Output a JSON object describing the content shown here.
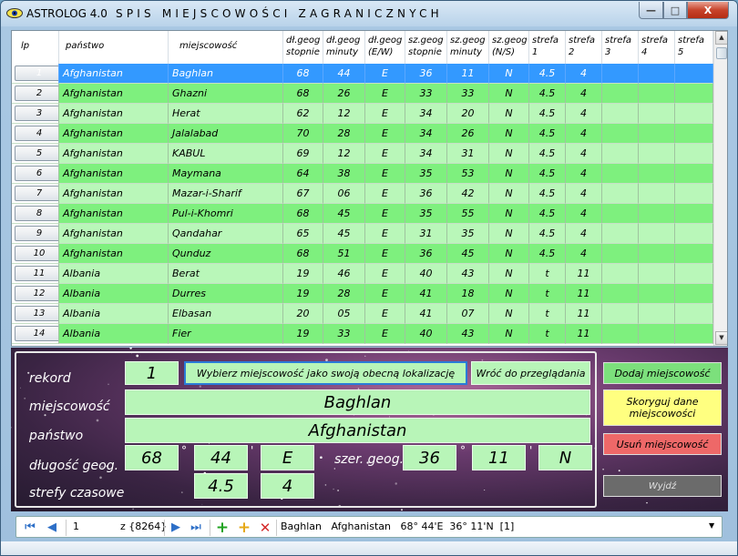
{
  "window": {
    "app_title": "ASTROLOG 4.0",
    "subtitle": "SPIS MIEJSCOWOŚCI ZAGRANICZNYCH",
    "min_label": "—",
    "max_label": "□",
    "close_label": "X"
  },
  "grid": {
    "columns": [
      "lp",
      "państwo",
      "miejscowość",
      "dł.geog\nstopnie",
      "dł.geog\nminuty",
      "dł.geog\n(E/W)",
      "sz.geog\nstopnie",
      "sz.geog\nminuty",
      "sz.geog\n(N/S)",
      "strefa\n1",
      "strefa\n2",
      "strefa\n3",
      "strefa\n4",
      "strefa\n5"
    ],
    "selected_row": 0,
    "rows": [
      {
        "lp": "1",
        "country": "Afghanistan",
        "city": "Baghlan",
        "lon_deg": "68",
        "lon_min": "44",
        "lon_dir": "E",
        "lat_deg": "36",
        "lat_min": "11",
        "lat_dir": "N",
        "tz1": "4.5",
        "tz2": "4"
      },
      {
        "lp": "2",
        "country": "Afghanistan",
        "city": "Ghazni",
        "lon_deg": "68",
        "lon_min": "26",
        "lon_dir": "E",
        "lat_deg": "33",
        "lat_min": "33",
        "lat_dir": "N",
        "tz1": "4.5",
        "tz2": "4"
      },
      {
        "lp": "3",
        "country": "Afghanistan",
        "city": "Herat",
        "lon_deg": "62",
        "lon_min": "12",
        "lon_dir": "E",
        "lat_deg": "34",
        "lat_min": "20",
        "lat_dir": "N",
        "tz1": "4.5",
        "tz2": "4"
      },
      {
        "lp": "4",
        "country": "Afghanistan",
        "city": "Jalalabad",
        "lon_deg": "70",
        "lon_min": "28",
        "lon_dir": "E",
        "lat_deg": "34",
        "lat_min": "26",
        "lat_dir": "N",
        "tz1": "4.5",
        "tz2": "4"
      },
      {
        "lp": "5",
        "country": "Afghanistan",
        "city": "KABUL",
        "lon_deg": "69",
        "lon_min": "12",
        "lon_dir": "E",
        "lat_deg": "34",
        "lat_min": "31",
        "lat_dir": "N",
        "tz1": "4.5",
        "tz2": "4"
      },
      {
        "lp": "6",
        "country": "Afghanistan",
        "city": "Maymana",
        "lon_deg": "64",
        "lon_min": "38",
        "lon_dir": "E",
        "lat_deg": "35",
        "lat_min": "53",
        "lat_dir": "N",
        "tz1": "4.5",
        "tz2": "4"
      },
      {
        "lp": "7",
        "country": "Afghanistan",
        "city": "Mazar-i-Sharif",
        "lon_deg": "67",
        "lon_min": "06",
        "lon_dir": "E",
        "lat_deg": "36",
        "lat_min": "42",
        "lat_dir": "N",
        "tz1": "4.5",
        "tz2": "4"
      },
      {
        "lp": "8",
        "country": "Afghanistan",
        "city": "Pul-i-Khomri",
        "lon_deg": "68",
        "lon_min": "45",
        "lon_dir": "E",
        "lat_deg": "35",
        "lat_min": "55",
        "lat_dir": "N",
        "tz1": "4.5",
        "tz2": "4"
      },
      {
        "lp": "9",
        "country": "Afghanistan",
        "city": "Qandahar",
        "lon_deg": "65",
        "lon_min": "45",
        "lon_dir": "E",
        "lat_deg": "31",
        "lat_min": "35",
        "lat_dir": "N",
        "tz1": "4.5",
        "tz2": "4"
      },
      {
        "lp": "10",
        "country": "Afghanistan",
        "city": "Qunduz",
        "lon_deg": "68",
        "lon_min": "51",
        "lon_dir": "E",
        "lat_deg": "36",
        "lat_min": "45",
        "lat_dir": "N",
        "tz1": "4.5",
        "tz2": "4"
      },
      {
        "lp": "11",
        "country": "Albania",
        "city": "Berat",
        "lon_deg": "19",
        "lon_min": "46",
        "lon_dir": "E",
        "lat_deg": "40",
        "lat_min": "43",
        "lat_dir": "N",
        "tz1": "t",
        "tz2": "11"
      },
      {
        "lp": "12",
        "country": "Albania",
        "city": "Durres",
        "lon_deg": "19",
        "lon_min": "28",
        "lon_dir": "E",
        "lat_deg": "41",
        "lat_min": "18",
        "lat_dir": "N",
        "tz1": "t",
        "tz2": "11"
      },
      {
        "lp": "13",
        "country": "Albania",
        "city": "Elbasan",
        "lon_deg": "20",
        "lon_min": "05",
        "lon_dir": "E",
        "lat_deg": "41",
        "lat_min": "07",
        "lat_dir": "N",
        "tz1": "t",
        "tz2": "11"
      },
      {
        "lp": "14",
        "country": "Albania",
        "city": "Fier",
        "lon_deg": "19",
        "lon_min": "33",
        "lon_dir": "E",
        "lat_deg": "40",
        "lat_min": "43",
        "lat_dir": "N",
        "tz1": "t",
        "tz2": "11"
      }
    ]
  },
  "form": {
    "label_record": "rekord",
    "label_city": "miejscowość",
    "label_country": "państwo",
    "label_lon": "długość geog.",
    "label_lat": "szer. geog.",
    "label_tz": "strefy czasowe",
    "record": "1",
    "city": "Baghlan",
    "country": "Afghanistan",
    "lon_deg": "68",
    "lon_min": "44",
    "lon_dir": "E",
    "lat_deg": "36",
    "lat_min": "11",
    "lat_dir": "N",
    "tz1": "4.5",
    "tz2": "4",
    "deg_sign": "°",
    "min_sign": "'",
    "btn_set_location": "Wybierz miejscowość jako swoją obecną lokalizację",
    "btn_back": "Wróć do przeglądania"
  },
  "side_buttons": {
    "add": "Dodaj miejscowość",
    "edit": "Skoryguj dane miejscowości",
    "delete": "Usuń miejscowość",
    "exit": "Wyjdź"
  },
  "navigator": {
    "position": "1",
    "count": "z {8264}",
    "record_summary": "Baghlan   Afghanistan   68° 44'E  36° 11'N  [1]"
  },
  "colors": {
    "row_green": "#7ef07e",
    "row_light": "#b9f7b9",
    "row_selected": "#3399ff",
    "btn_add": "#7ce07c",
    "btn_edit": "#ffff80",
    "btn_delete": "#ee6868",
    "btn_exit": "#6b6b6b"
  }
}
